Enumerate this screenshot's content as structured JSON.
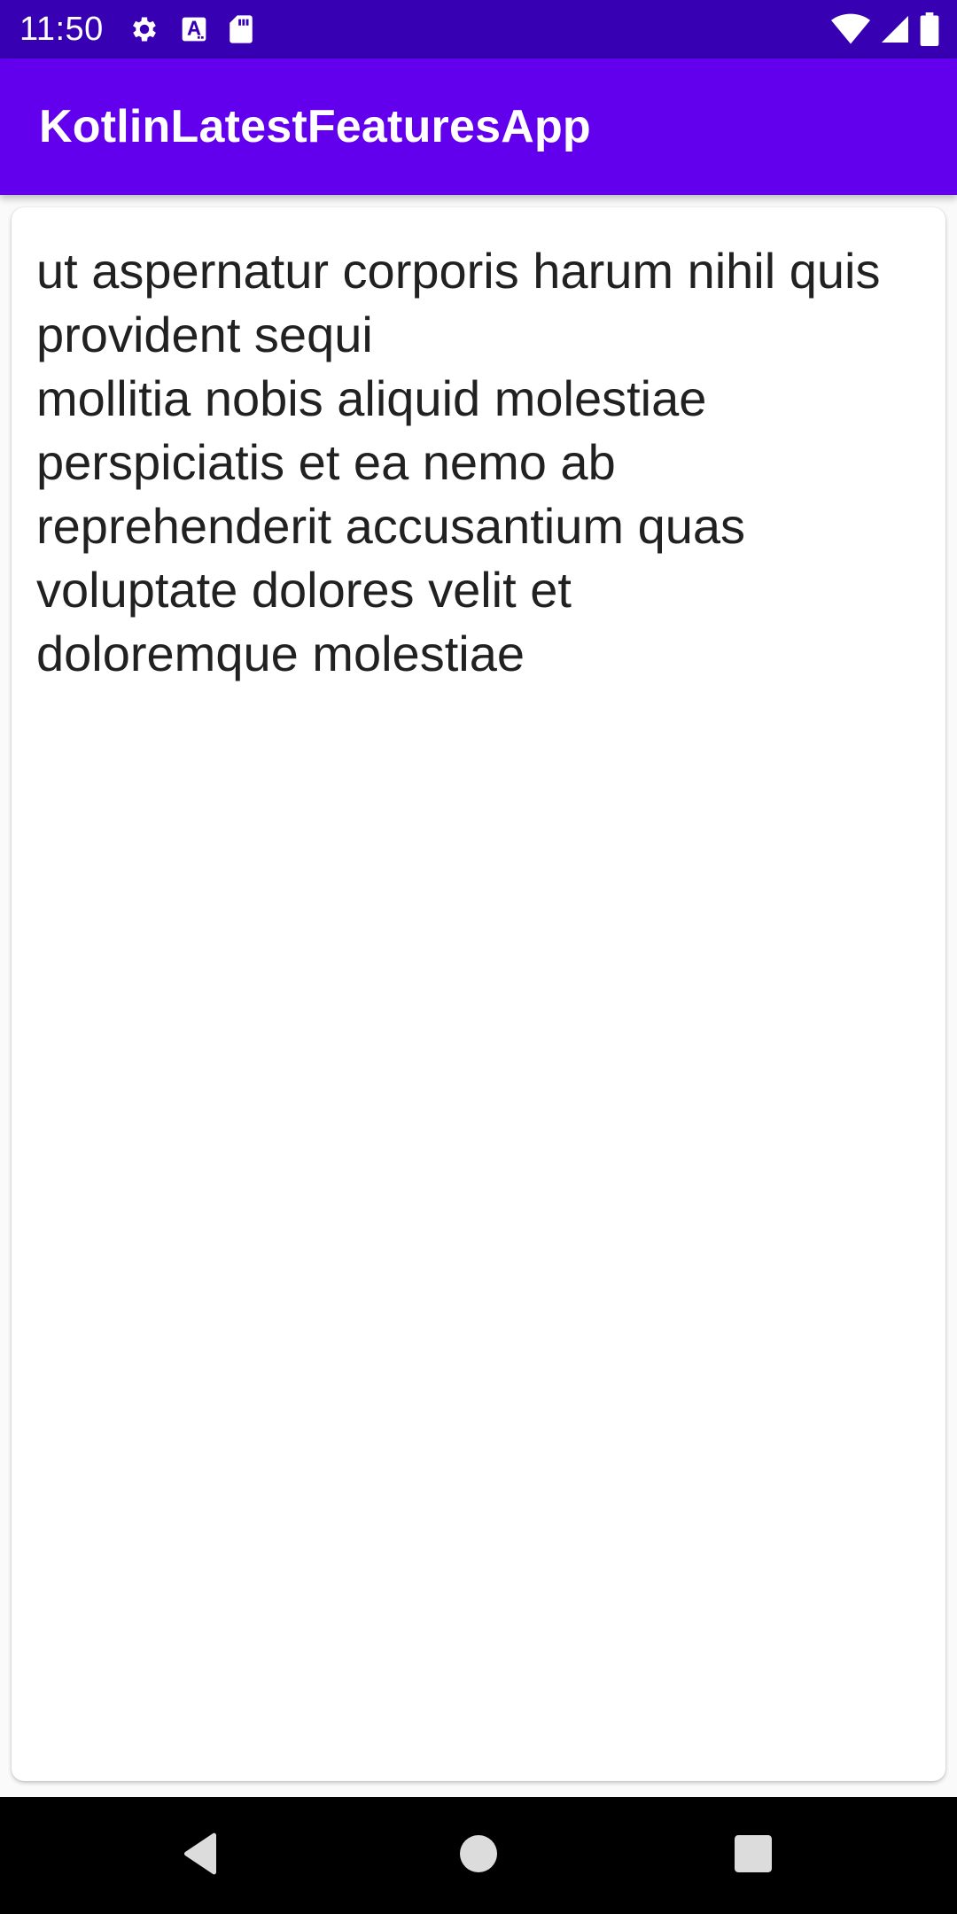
{
  "status_bar": {
    "time": "11:50",
    "left_icons": [
      "settings-gear-icon",
      "font-a-icon",
      "sd-card-icon"
    ],
    "right_icons": [
      "wifi-icon",
      "cell-signal-icon",
      "battery-icon"
    ]
  },
  "app_bar": {
    "title": "KotlinLatestFeaturesApp",
    "color": "#6200ee"
  },
  "card": {
    "title": "ut aspernatur corporis harum nihil quis provident sequi",
    "body": "mollitia nobis aliquid molestiae\nperspiciatis et ea nemo ab\nreprehenderit accusantium quas\nvoluptate dolores velit et\ndoloremque molestiae"
  },
  "nav_bar": {
    "buttons": [
      "back-icon",
      "home-icon",
      "recents-icon"
    ]
  },
  "colors": {
    "status_bar": "#3700b3",
    "app_bar": "#6200ee",
    "text": "#212121",
    "nav_bar": "#000000"
  }
}
